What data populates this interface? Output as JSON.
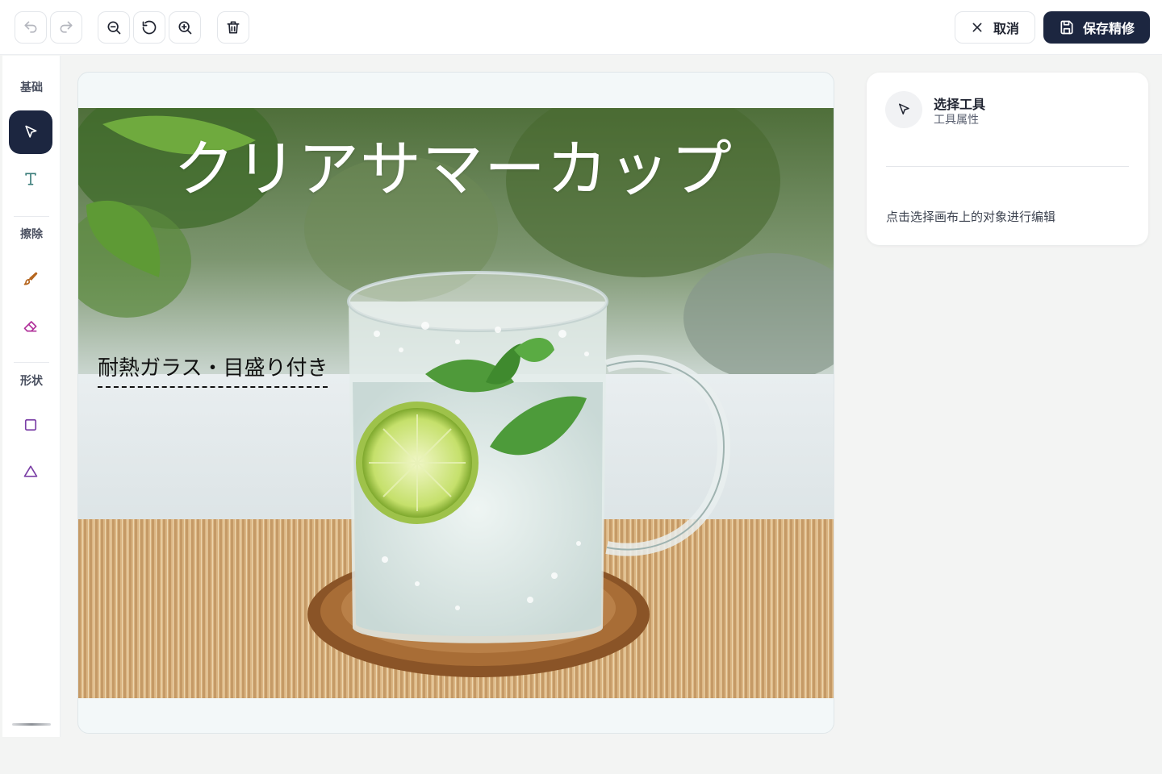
{
  "toolbar": {
    "undo_icon": "undo-icon",
    "redo_icon": "redo-icon",
    "zoom_out_icon": "zoom-out-icon",
    "reset_icon": "rotate-ccw-icon",
    "zoom_in_icon": "zoom-in-icon",
    "delete_icon": "trash-icon",
    "cancel_label": "取消",
    "save_label": "保存精修"
  },
  "sidebar": {
    "sections": [
      {
        "label": "基础",
        "tools": [
          "select-tool",
          "text-tool"
        ]
      },
      {
        "label": "擦除",
        "tools": [
          "brush-tool",
          "eraser-tool"
        ]
      },
      {
        "label": "形状",
        "tools": [
          "rectangle-tool",
          "triangle-tool"
        ]
      }
    ],
    "active_tool": "select-tool"
  },
  "canvas": {
    "title": "クリアサマーカップ",
    "subtitle": "耐熱ガラス・目盛り付き"
  },
  "panel": {
    "icon": "cursor-arrow-icon",
    "title": "选择工具",
    "subtitle": "工具属性",
    "hint": "点击选择画布上的对象进行编辑"
  },
  "colors": {
    "primary": "#1c2640",
    "tool_accent": "#3b7d7a",
    "brush_accent": "#b5651d",
    "shape_accent": "#7b3fa6"
  }
}
